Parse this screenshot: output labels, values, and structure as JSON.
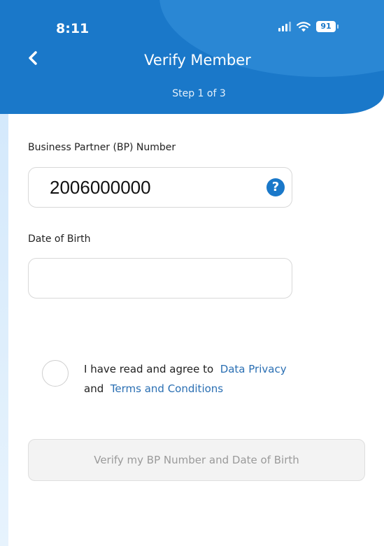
{
  "status_bar": {
    "time": "8:11",
    "battery": "91",
    "icons": [
      "signal-icon",
      "wifi-icon",
      "battery-icon"
    ]
  },
  "header": {
    "back_icon": "chevron-left-icon",
    "title": "Verify Member",
    "step": "Step 1 of 3"
  },
  "form": {
    "bp_number": {
      "label": "Business Partner (BP) Number",
      "value": "2006000000",
      "help_icon": "question-circle-icon",
      "help_glyph": "?"
    },
    "date_of_birth": {
      "label": "Date of Birth",
      "value": ""
    }
  },
  "consent": {
    "checked": false,
    "text_before": "I have read and agree to",
    "link_privacy": "Data Privacy",
    "text_and": "and",
    "link_terms": "Terms and Conditions"
  },
  "verify_button": {
    "label": "Verify my BP Number and Date of Birth",
    "enabled": false
  },
  "colors": {
    "header_blue": "#1a78c9",
    "link_blue": "#2a6fb3",
    "disabled_text": "#9a9a9a"
  }
}
